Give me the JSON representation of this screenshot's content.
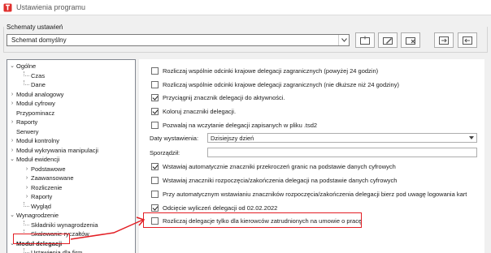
{
  "window": {
    "title": "Ustawienia programu"
  },
  "schemes": {
    "group_label": "Schematy ustawień",
    "selected": "Schemat domyślny"
  },
  "tree": {
    "items": [
      {
        "label": "Ogólne",
        "level": 0,
        "expander": "open"
      },
      {
        "label": "Czas",
        "level": 1,
        "expander": "none"
      },
      {
        "label": "Dane",
        "level": 1,
        "expander": "none"
      },
      {
        "label": "Moduł analogowy",
        "level": 0,
        "expander": "closed"
      },
      {
        "label": "Moduł cyfrowy",
        "level": 0,
        "expander": "closed"
      },
      {
        "label": "Przypominacz",
        "level": 0,
        "expander": "none"
      },
      {
        "label": "Raporty",
        "level": 0,
        "expander": "closed"
      },
      {
        "label": "Serwery",
        "level": 0,
        "expander": "none"
      },
      {
        "label": "Moduł kontrolny",
        "level": 0,
        "expander": "closed"
      },
      {
        "label": "Moduł wykrywania manipulacji",
        "level": 0,
        "expander": "closed"
      },
      {
        "label": "Moduł ewidencji",
        "level": 0,
        "expander": "open"
      },
      {
        "label": "Podstawowe",
        "level": 1,
        "expander": "closed"
      },
      {
        "label": "Zaawansowane",
        "level": 1,
        "expander": "closed"
      },
      {
        "label": "Rozliczenie",
        "level": 1,
        "expander": "closed"
      },
      {
        "label": "Raporty",
        "level": 1,
        "expander": "closed"
      },
      {
        "label": "Wygląd",
        "level": 1,
        "expander": "none"
      },
      {
        "label": "Wynagrodzenie",
        "level": 0,
        "expander": "open"
      },
      {
        "label": "Składniki wynagrodzenia",
        "level": 1,
        "expander": "none"
      },
      {
        "label": "Skalowanie ryczałtów",
        "level": 1,
        "expander": "none"
      },
      {
        "label": "Moduł delegacji",
        "level": 0,
        "expander": "open",
        "selected": true
      },
      {
        "label": "Ustawienia dla firm",
        "level": 1,
        "expander": "none"
      }
    ]
  },
  "settings": {
    "checkboxes_top": [
      {
        "label": "Rozliczaj wspólnie odcinki krajowe delegacji zagranicznych (powyżej 24 godzin)",
        "checked": false
      },
      {
        "label": "Rozliczaj wspólnie odcinki krajowe delegacji zagranicznych (nie dłuższe niż 24 godziny)",
        "checked": false
      },
      {
        "label": "Przyciągnij znacznik delegacji do aktywności.",
        "checked": true
      },
      {
        "label": "Koloruj znaczniki delegacji.",
        "checked": true
      },
      {
        "label": "Pozwalaj na wczytanie delegacji zapisanych w pliku .tsd2",
        "checked": false
      }
    ],
    "issue_date_label": "Daty wystawienia:",
    "issue_date_value": "Dzisiejszy dzień",
    "prepared_by_label": "Sporządził:",
    "prepared_by_value": "",
    "checkboxes_bottom": [
      {
        "label": "Wstawiaj automatycznie znaczniki przekroczeń granic na podstawie danych cyfrowych",
        "checked": true
      },
      {
        "label": "Wstawiaj znaczniki rozpoczęcia/zakończenia delegacji na podstawie danych cyfrowych",
        "checked": false
      },
      {
        "label": "Przy automatycznym wstawianiu znaczników rozpoczęcia/zakończenia delegacji bierz pod uwagę logowania kart",
        "checked": false
      },
      {
        "label": "Odcięcie wyliczeń delegacji od 02.02.2022",
        "checked": true
      },
      {
        "label": "Rozliczaj delegacje tylko dla kierowców zatrudnionych na umowie o pracę",
        "checked": false,
        "highlighted": true
      }
    ]
  },
  "colors": {
    "highlight": "#e31e24",
    "accent_icon": "#e0302e"
  }
}
